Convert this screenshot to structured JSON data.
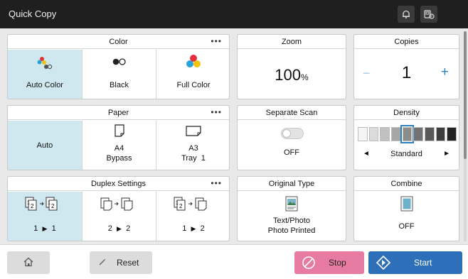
{
  "header": {
    "title": "Quick Copy",
    "bell_icon": "bell-icon",
    "device_icon": "device-status-icon"
  },
  "color": {
    "title": "Color",
    "more": "•••",
    "options": [
      {
        "label": "Auto Color",
        "icon": "auto-color-icon",
        "selected": true
      },
      {
        "label": "Black",
        "icon": "black-icon",
        "selected": false
      },
      {
        "label": "Full Color",
        "icon": "full-color-icon",
        "selected": false
      }
    ]
  },
  "zoom": {
    "title": "Zoom",
    "value": "100",
    "unit": "%"
  },
  "copies": {
    "title": "Copies",
    "minus": "−",
    "value": "1",
    "plus": "+"
  },
  "paper": {
    "title": "Paper",
    "more": "•••",
    "options": [
      {
        "label": "Auto",
        "selected": true
      },
      {
        "line1": "A4",
        "line2": "Bypass",
        "icon": "portrait-paper-icon",
        "selected": false
      },
      {
        "line1": "A3",
        "line2": "Tray  1",
        "icon": "landscape-paper-icon",
        "selected": false
      }
    ]
  },
  "separate_scan": {
    "title": "Separate Scan",
    "value": "OFF",
    "toggle_on": false
  },
  "density": {
    "title": "Density",
    "value": "Standard",
    "levels": 9,
    "selected_level": 5,
    "left_arrow": "◄",
    "right_arrow": "►"
  },
  "duplex": {
    "title": "Duplex Settings",
    "more": "•••",
    "options": [
      {
        "from": "1",
        "arrow": "▶",
        "to": "1",
        "selected": true
      },
      {
        "from": "2",
        "arrow": "▶",
        "to": "2",
        "selected": false
      },
      {
        "from": "1",
        "arrow": "▶",
        "to": "2",
        "selected": false
      }
    ]
  },
  "original_type": {
    "title": "Original Type",
    "line1": "Text/Photo",
    "line2": "Photo Printed"
  },
  "combine": {
    "title": "Combine",
    "value": "OFF"
  },
  "footer": {
    "reset": "Reset",
    "stop": "Stop",
    "start": "Start"
  },
  "colors": {
    "selected_bg": "#cfe8ef",
    "accent_blue": "#2e7fbd",
    "stop_pink": "#e77aa0",
    "start_blue": "#2d6fb8"
  }
}
